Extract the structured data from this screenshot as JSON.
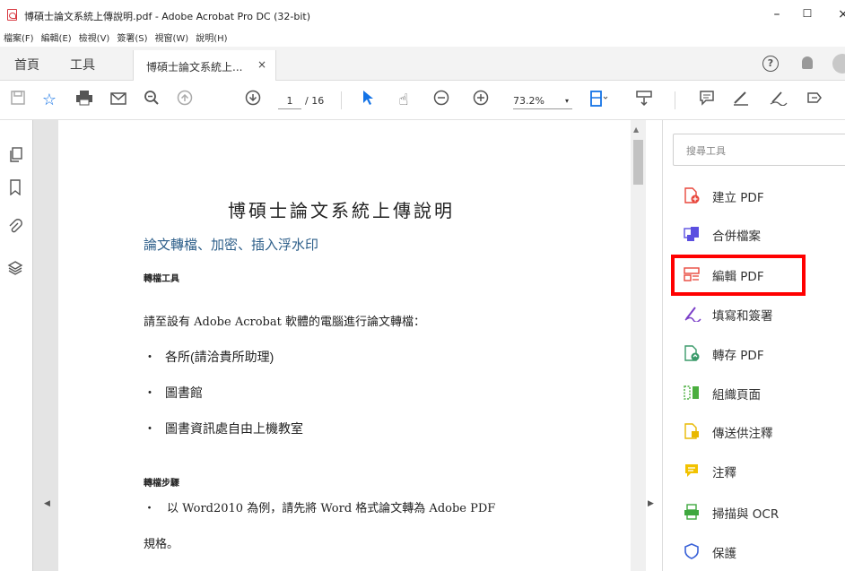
{
  "window": {
    "title": "博碩士論文系統上傳說明.pdf - Adobe Acrobat Pro DC (32-bit)",
    "min_glyph": "–",
    "max_glyph": "☐",
    "close_glyph": "×"
  },
  "menu": [
    "檔案(F)",
    "編輯(E)",
    "檢視(V)",
    "簽署(S)",
    "視窗(W)",
    "說明(H)"
  ],
  "tabs": {
    "home": "首頁",
    "tools": "工具",
    "doc": "博碩士論文系統上...",
    "doc_close": "×"
  },
  "toolbar": {
    "page_current": "1",
    "page_total": "/ 16",
    "zoom": "73.2%",
    "zoom_caret": "▾"
  },
  "icons": {
    "help": "?"
  },
  "document": {
    "title": "博碩士論文系統上傳說明",
    "section": "論文轉檔、加密、插入浮水印",
    "label1": "轉檔工具",
    "para1": "請至設有 Adobe Acrobat 軟體的電腦進行論文轉檔：",
    "bullet": "・",
    "list": [
      "各所(請洽貴所助理)",
      "圖書館",
      "圖書資訊處自由上機教室"
    ],
    "label2": "轉檔步驟",
    "step1": "・　以 Word2010 為例，請先將 Word 格式論文轉為 Adobe PDF",
    "step1b": "規格。"
  },
  "tools_pane": {
    "search_placeholder": "搜尋工具",
    "items": [
      {
        "label": "建立 PDF",
        "icon": "create-pdf-icon",
        "color": "#e8473c"
      },
      {
        "label": "合併檔案",
        "icon": "combine-files-icon",
        "color": "#5b4fe0"
      },
      {
        "label": "編輯 PDF",
        "icon": "edit-pdf-icon",
        "color": "#e8473c"
      },
      {
        "label": "填寫和簽署",
        "icon": "fill-sign-icon",
        "color": "#7b3fc8"
      },
      {
        "label": "轉存 PDF",
        "icon": "export-pdf-icon",
        "color": "#3a9a6a"
      },
      {
        "label": "組織頁面",
        "icon": "organize-pages-icon",
        "color": "#4aae3e"
      },
      {
        "label": "傳送供注釋",
        "icon": "send-comments-icon",
        "color": "#e8b800"
      },
      {
        "label": "注釋",
        "icon": "comment-icon",
        "color": "#f2c200"
      },
      {
        "label": "掃描與 OCR",
        "icon": "scan-ocr-icon",
        "color": "#3fa83f"
      },
      {
        "label": "保護",
        "icon": "protect-icon",
        "color": "#3a62d8"
      }
    ]
  }
}
